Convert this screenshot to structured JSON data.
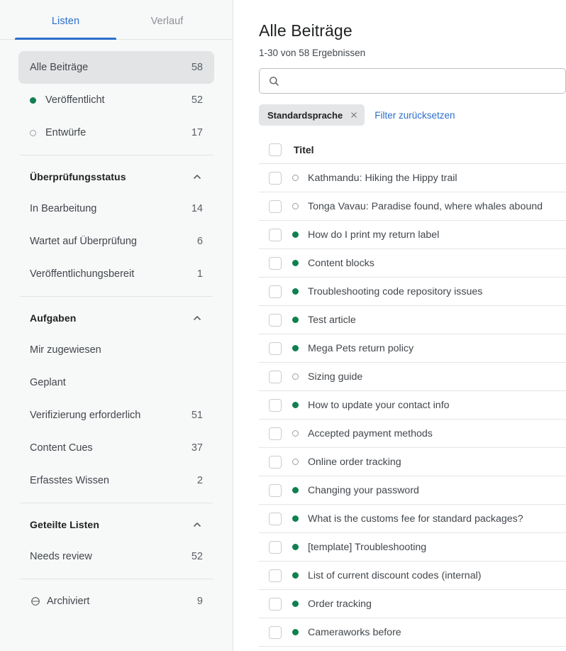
{
  "sidebar": {
    "tabs": [
      {
        "label": "Listen",
        "active": true
      },
      {
        "label": "Verlauf",
        "active": false
      }
    ],
    "top_items": [
      {
        "label": "Alle Beiträge",
        "count": "58",
        "status": "none",
        "selected": true
      },
      {
        "label": "Veröffentlicht",
        "count": "52",
        "status": "published",
        "selected": false
      },
      {
        "label": "Entwürfe",
        "count": "17",
        "status": "draft",
        "selected": false
      }
    ],
    "sections": [
      {
        "title": "Überprüfungsstatus",
        "collapse_icon": "chevron-up-icon",
        "items": [
          {
            "label": "In Bearbeitung",
            "count": "14"
          },
          {
            "label": "Wartet auf Überprüfung",
            "count": "6"
          },
          {
            "label": "Veröffentlichungsbereit",
            "count": "1"
          }
        ]
      },
      {
        "title": "Aufgaben",
        "collapse_icon": "chevron-up-icon",
        "items": [
          {
            "label": "Mir zugewiesen",
            "count": ""
          },
          {
            "label": "Geplant",
            "count": ""
          },
          {
            "label": "Verifizierung erforderlich",
            "count": "51"
          },
          {
            "label": "Content Cues",
            "count": "37"
          },
          {
            "label": "Erfasstes Wissen",
            "count": "2"
          }
        ]
      },
      {
        "title": "Geteilte Listen",
        "collapse_icon": "chevron-up-icon",
        "items": [
          {
            "label": "Needs review",
            "count": "52"
          }
        ]
      }
    ],
    "archived": {
      "label": "Archiviert",
      "count": "9",
      "icon": "archive-icon"
    }
  },
  "main": {
    "title": "Alle Beiträge",
    "result_count": "1-30 von 58 Ergebnissen",
    "search": {
      "value": "",
      "placeholder": "",
      "icon": "search-icon"
    },
    "filters": {
      "chip_label": "Standardsprache",
      "chip_remove_icon": "close-icon",
      "reset_label": "Filter zurücksetzen"
    },
    "table": {
      "header": {
        "title": "Titel"
      },
      "rows": [
        {
          "title": "Kathmandu: Hiking the Hippy trail",
          "status": "draft"
        },
        {
          "title": "Tonga Vavau: Paradise found, where whales abound",
          "status": "draft"
        },
        {
          "title": "How do I print my return label",
          "status": "published"
        },
        {
          "title": "Content blocks",
          "status": "published"
        },
        {
          "title": "Troubleshooting code repository issues",
          "status": "published"
        },
        {
          "title": "Test article",
          "status": "published"
        },
        {
          "title": "Mega Pets return policy",
          "status": "published"
        },
        {
          "title": "Sizing guide",
          "status": "draft"
        },
        {
          "title": "How to update your contact info",
          "status": "published"
        },
        {
          "title": "Accepted payment methods",
          "status": "draft"
        },
        {
          "title": "Online order tracking",
          "status": "draft"
        },
        {
          "title": "Changing your password",
          "status": "published"
        },
        {
          "title": "What is the customs fee for standard packages?",
          "status": "published"
        },
        {
          "title": "[template] Troubleshooting",
          "status": "published"
        },
        {
          "title": "List of current discount codes (internal)",
          "status": "published"
        },
        {
          "title": "Order tracking",
          "status": "published"
        },
        {
          "title": "Cameraworks before",
          "status": "published"
        }
      ]
    }
  },
  "colors": {
    "accent_blue": "#2c6ecb",
    "published_green": "#0f8050",
    "sidebar_bg": "#f7f8f8",
    "selected_bg": "#e3e4e5",
    "chip_bg": "#e4e5e7"
  }
}
